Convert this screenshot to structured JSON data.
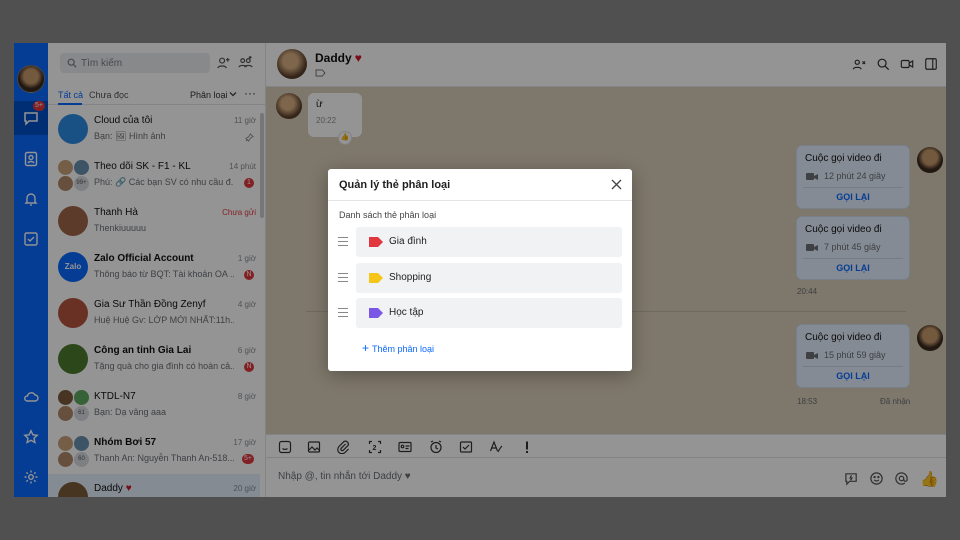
{
  "sidebar": {
    "chat_badge": "5+"
  },
  "conv_panel": {
    "search_placeholder": "Tìm kiếm",
    "tab_all": "Tất cả",
    "tab_unread": "Chưa đọc",
    "filter_label": "Phân loại",
    "more": "···"
  },
  "conversations": [
    {
      "name": "Cloud của tôi",
      "preview": "Bạn: 🖼 Hình ảnh",
      "time": "11 giờ",
      "bold": false,
      "color": "#2d8ce6"
    },
    {
      "name": "Theo dõi SK - F1 - KL",
      "preview": "Phú: 🔗 Các bạn SV có nhu cầu đ...",
      "time": "14 phút",
      "badge": "1",
      "count": "99+",
      "group": true
    },
    {
      "name": "Thanh Hà",
      "preview": "Thenkiuuuuu",
      "time": "Chưa gửi",
      "time_red": true,
      "color": "#a0674a"
    },
    {
      "name": "Zalo Official Account",
      "preview": "Thông báo từ BQT: Tài khoản OA ...",
      "time": "1 giờ",
      "badge": "N",
      "bold": true,
      "color": "#0a68ff",
      "avatar_text": "Zalo"
    },
    {
      "name": "Gia Sư Thần Đồng Zenyf",
      "preview": "Huệ Huệ Gv: LỚP MỚI NHẤT:11h...",
      "time": "4 giờ",
      "color": "#b4553f"
    },
    {
      "name": "Công an tỉnh Gia Lai",
      "preview": "Tặng quà cho gia đình có hoàn cả...",
      "time": "6 giờ",
      "badge": "N",
      "bold": true,
      "color": "#4c7a2c"
    },
    {
      "name": "KTDL-N7",
      "preview": "Bạn: Dạ vâng aaa",
      "time": "8 giờ",
      "count": "61",
      "group": true
    },
    {
      "name": "Nhóm Bơi 57",
      "preview": "Thanh An: Nguyễn Thanh An-518...",
      "time": "17 giờ",
      "badge": "5+",
      "count": "60",
      "group": true,
      "bold": true
    },
    {
      "name": "Daddy",
      "preview": "",
      "time": "20 giờ",
      "heart": true,
      "selected": true,
      "color": "#7a5a3a"
    }
  ],
  "chat": {
    "title": "Daddy",
    "heart": "♥",
    "incoming_text": "ừ",
    "incoming_time": "20:22",
    "calls": [
      {
        "title": "Cuộc gọi video đi",
        "duration": "12 phút 24 giây",
        "button": "GỌI LẠI"
      },
      {
        "title": "Cuộc gọi video đi",
        "duration": "7 phút 45 giây",
        "button": "GỌI LẠI"
      },
      {
        "title": "Cuộc gọi video đi",
        "duration": "15 phút 59 giây",
        "button": "GỌI LẠI"
      }
    ],
    "stamp1": "20:44",
    "stamp2": "18:53",
    "received": "Đã nhận",
    "composer_placeholder": "Nhập @, tin nhắn tới Daddy ♥"
  },
  "modal": {
    "title": "Quản lý thẻ phân loại",
    "subtitle": "Danh sách thẻ phân loại",
    "tags": [
      {
        "label": "Gia đình",
        "color": "#e0383e"
      },
      {
        "label": "Shopping",
        "color": "#f5c518"
      },
      {
        "label": "Học tập",
        "color": "#7b57e6"
      }
    ],
    "add_label": "Thêm phân loại",
    "add_plus": "+"
  }
}
